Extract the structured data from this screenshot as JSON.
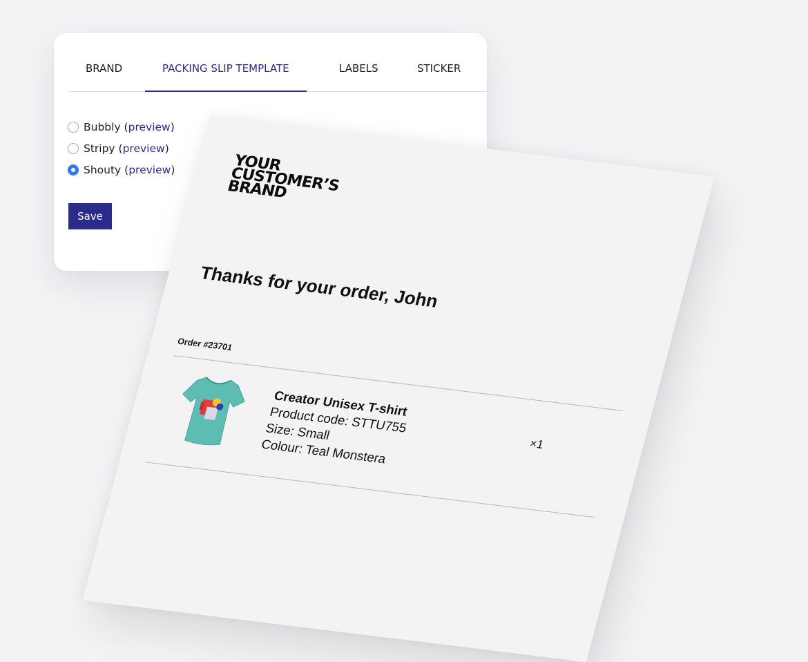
{
  "settings": {
    "tabs": [
      {
        "label": "BRAND",
        "active": false
      },
      {
        "label": "PACKING SLIP TEMPLATE",
        "active": true
      },
      {
        "label": "LABELS",
        "active": false
      },
      {
        "label": "STICKER",
        "active": false
      }
    ],
    "templates": [
      {
        "name": "Bubbly",
        "link": "preview",
        "selected": false
      },
      {
        "name": "Stripy",
        "link": "preview",
        "selected": false
      },
      {
        "name": "Shouty",
        "link": "preview",
        "selected": true
      }
    ],
    "save_label": "Save",
    "colors": {
      "accent": "#2b2b8c",
      "radio_selected": "#2f7bef"
    }
  },
  "packing_slip": {
    "brand_lines": [
      "YOUR",
      "CUSTOMER’S",
      "BRAND"
    ],
    "greeting": "Thanks for your order, John",
    "order_label": "Order #23701",
    "item": {
      "name": "Creator Unisex T-shirt",
      "product_code": "Product code: STTU755",
      "size": "Size: Small",
      "colour": "Colour: Teal Monstera",
      "quantity": "×1",
      "image_icon": "t-shirt-icon",
      "shirt_color": "#5dbdb3"
    }
  }
}
